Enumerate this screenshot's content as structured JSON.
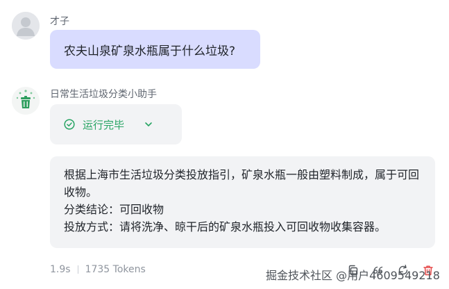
{
  "user": {
    "name": "才子",
    "message": "农夫山泉矿泉水瓶属于什么垃圾?"
  },
  "bot": {
    "name": "日常生活垃圾分类小助手",
    "status_label": "运行完毕",
    "status_color": "#27a463",
    "icons": {
      "status": "check-circle-icon",
      "toggle": "chevron-down-icon",
      "avatar": "trash-bin-icon"
    },
    "answer": {
      "line1": "根据上海市生活垃圾分类投放指引，矿泉水瓶一般由塑料制成，属于可回收物。",
      "line2": "分类结论：可回收物",
      "line3": "投放方式：请将洗净、晾干后的矿泉水瓶投入可回收物收集容器。"
    }
  },
  "meta": {
    "duration": "1.9s",
    "tokens": "1735 Tokens"
  },
  "watermark": "掘金技术社区 @用户4609549218",
  "actions": [
    "copy-icon",
    "quote-icon",
    "regenerate-icon",
    "delete-icon"
  ],
  "colors": {
    "user_bubble": "#d9dcff",
    "card_bg": "#f2f3f5",
    "delete": "#e54545"
  }
}
